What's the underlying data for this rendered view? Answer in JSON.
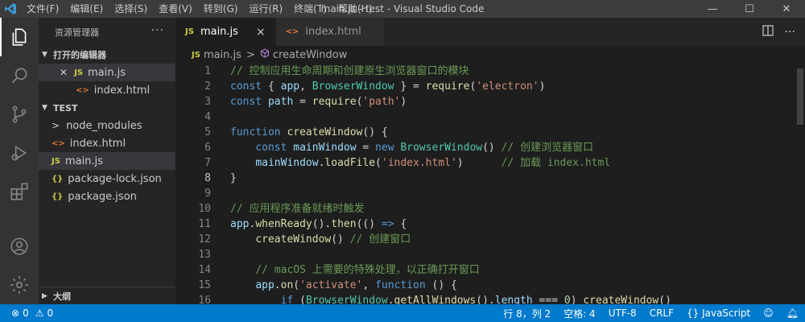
{
  "titlebar": {
    "menu": [
      "文件(F)",
      "编辑(E)",
      "选择(S)",
      "查看(V)",
      "转到(G)",
      "运行(R)",
      "终端(T)",
      "帮助(H)"
    ],
    "title": "main.js - test - Visual Studio Code",
    "minimize": "—",
    "maximize": "☐",
    "close": "✕"
  },
  "sidebar": {
    "title": "资源管理器",
    "more": "···",
    "open_editors": {
      "label": "打开的编辑器",
      "items": [
        {
          "icon": "JS",
          "name": "main.js"
        },
        {
          "icon": "<>",
          "name": "index.html"
        }
      ]
    },
    "folder": {
      "label": "TEST",
      "items": [
        {
          "icon": ">",
          "name": "node_modules"
        },
        {
          "icon": "<>",
          "name": "index.html"
        },
        {
          "icon": "JS",
          "name": "main.js"
        },
        {
          "icon": "{}",
          "name": "package-lock.json"
        },
        {
          "icon": "{}",
          "name": "package.json"
        }
      ]
    },
    "outline": "大纲"
  },
  "tabs": [
    {
      "icon": "JS",
      "name": "main.js",
      "close": "×"
    },
    {
      "icon": "<>",
      "name": "index.html"
    }
  ],
  "breadcrumb": {
    "file": "main.js",
    "sep": ">",
    "symbol": "createWindow"
  },
  "code": {
    "current_line": 8,
    "lines": [
      [
        [
          "cm",
          "// 控制应用生命周期和创建原生浏览器窗口的模块"
        ]
      ],
      [
        [
          "kw",
          "const"
        ],
        [
          "pl",
          " { "
        ],
        [
          "vr",
          "app"
        ],
        [
          "pl",
          ", "
        ],
        [
          "cl",
          "BrowserWindow"
        ],
        [
          "pl",
          " } = "
        ],
        [
          "fn",
          "require"
        ],
        [
          "pl",
          "("
        ],
        [
          "st",
          "'electron'"
        ],
        [
          "pl",
          ")"
        ]
      ],
      [
        [
          "kw",
          "const"
        ],
        [
          "pl",
          " "
        ],
        [
          "vr",
          "path"
        ],
        [
          "pl",
          " = "
        ],
        [
          "fn",
          "require"
        ],
        [
          "pl",
          "("
        ],
        [
          "st",
          "'path'"
        ],
        [
          "pl",
          ")"
        ]
      ],
      [],
      [
        [
          "kw",
          "function"
        ],
        [
          "pl",
          " "
        ],
        [
          "fn",
          "createWindow"
        ],
        [
          "pl",
          "() {"
        ]
      ],
      [
        [
          "pl",
          "    "
        ],
        [
          "kw",
          "const"
        ],
        [
          "pl",
          " "
        ],
        [
          "vr",
          "mainWindow"
        ],
        [
          "pl",
          " = "
        ],
        [
          "kw",
          "new"
        ],
        [
          "pl",
          " "
        ],
        [
          "cl",
          "BrowserWindow"
        ],
        [
          "pl",
          "() "
        ],
        [
          "cm",
          "// 创建浏览器窗口"
        ]
      ],
      [
        [
          "pl",
          "    "
        ],
        [
          "vr",
          "mainWindow"
        ],
        [
          "pl",
          "."
        ],
        [
          "fn",
          "loadFile"
        ],
        [
          "pl",
          "("
        ],
        [
          "st",
          "'index.html'"
        ],
        [
          "pl",
          ")      "
        ],
        [
          "cm",
          "// 加载 index.html"
        ]
      ],
      [
        [
          "pl",
          "}"
        ]
      ],
      [],
      [
        [
          "cm",
          "// 应用程序准备就绪时触发"
        ]
      ],
      [
        [
          "vr",
          "app"
        ],
        [
          "pl",
          "."
        ],
        [
          "fn",
          "whenReady"
        ],
        [
          "pl",
          "()."
        ],
        [
          "fn",
          "then"
        ],
        [
          "pl",
          "(() "
        ],
        [
          "kw",
          "=>"
        ],
        [
          "pl",
          " {"
        ]
      ],
      [
        [
          "pl",
          "    "
        ],
        [
          "fn",
          "createWindow"
        ],
        [
          "pl",
          "() "
        ],
        [
          "cm",
          "// 创建窗口"
        ]
      ],
      [],
      [
        [
          "pl",
          "    "
        ],
        [
          "cm",
          "// macOS 上需要的特殊处理，以正确打开窗口"
        ]
      ],
      [
        [
          "pl",
          "    "
        ],
        [
          "vr",
          "app"
        ],
        [
          "pl",
          "."
        ],
        [
          "fn",
          "on"
        ],
        [
          "pl",
          "("
        ],
        [
          "st",
          "'activate'"
        ],
        [
          "pl",
          ", "
        ],
        [
          "kw",
          "function"
        ],
        [
          "pl",
          " () {"
        ]
      ],
      [
        [
          "pl",
          "        "
        ],
        [
          "kw",
          "if"
        ],
        [
          "pl",
          " ("
        ],
        [
          "cl",
          "BrowserWindow"
        ],
        [
          "pl",
          "."
        ],
        [
          "fn",
          "getAllWindows"
        ],
        [
          "pl",
          "()."
        ],
        [
          "vr",
          "length"
        ],
        [
          "pl",
          " === "
        ],
        [
          "nm",
          "0"
        ],
        [
          "pl",
          ") "
        ],
        [
          "fn",
          "createWindow"
        ],
        [
          "pl",
          "()"
        ]
      ]
    ]
  },
  "statusbar": {
    "errors": "0",
    "warnings": "0",
    "position": "行 8，列 2",
    "spaces": "空格: 4",
    "encoding": "UTF-8",
    "eol": "CRLF",
    "language": "{} JavaScript"
  },
  "colors": {
    "accent": "#007acc",
    "activity_bar": "#333333",
    "sidebar": "#252526",
    "editor": "#1e1e1e"
  }
}
